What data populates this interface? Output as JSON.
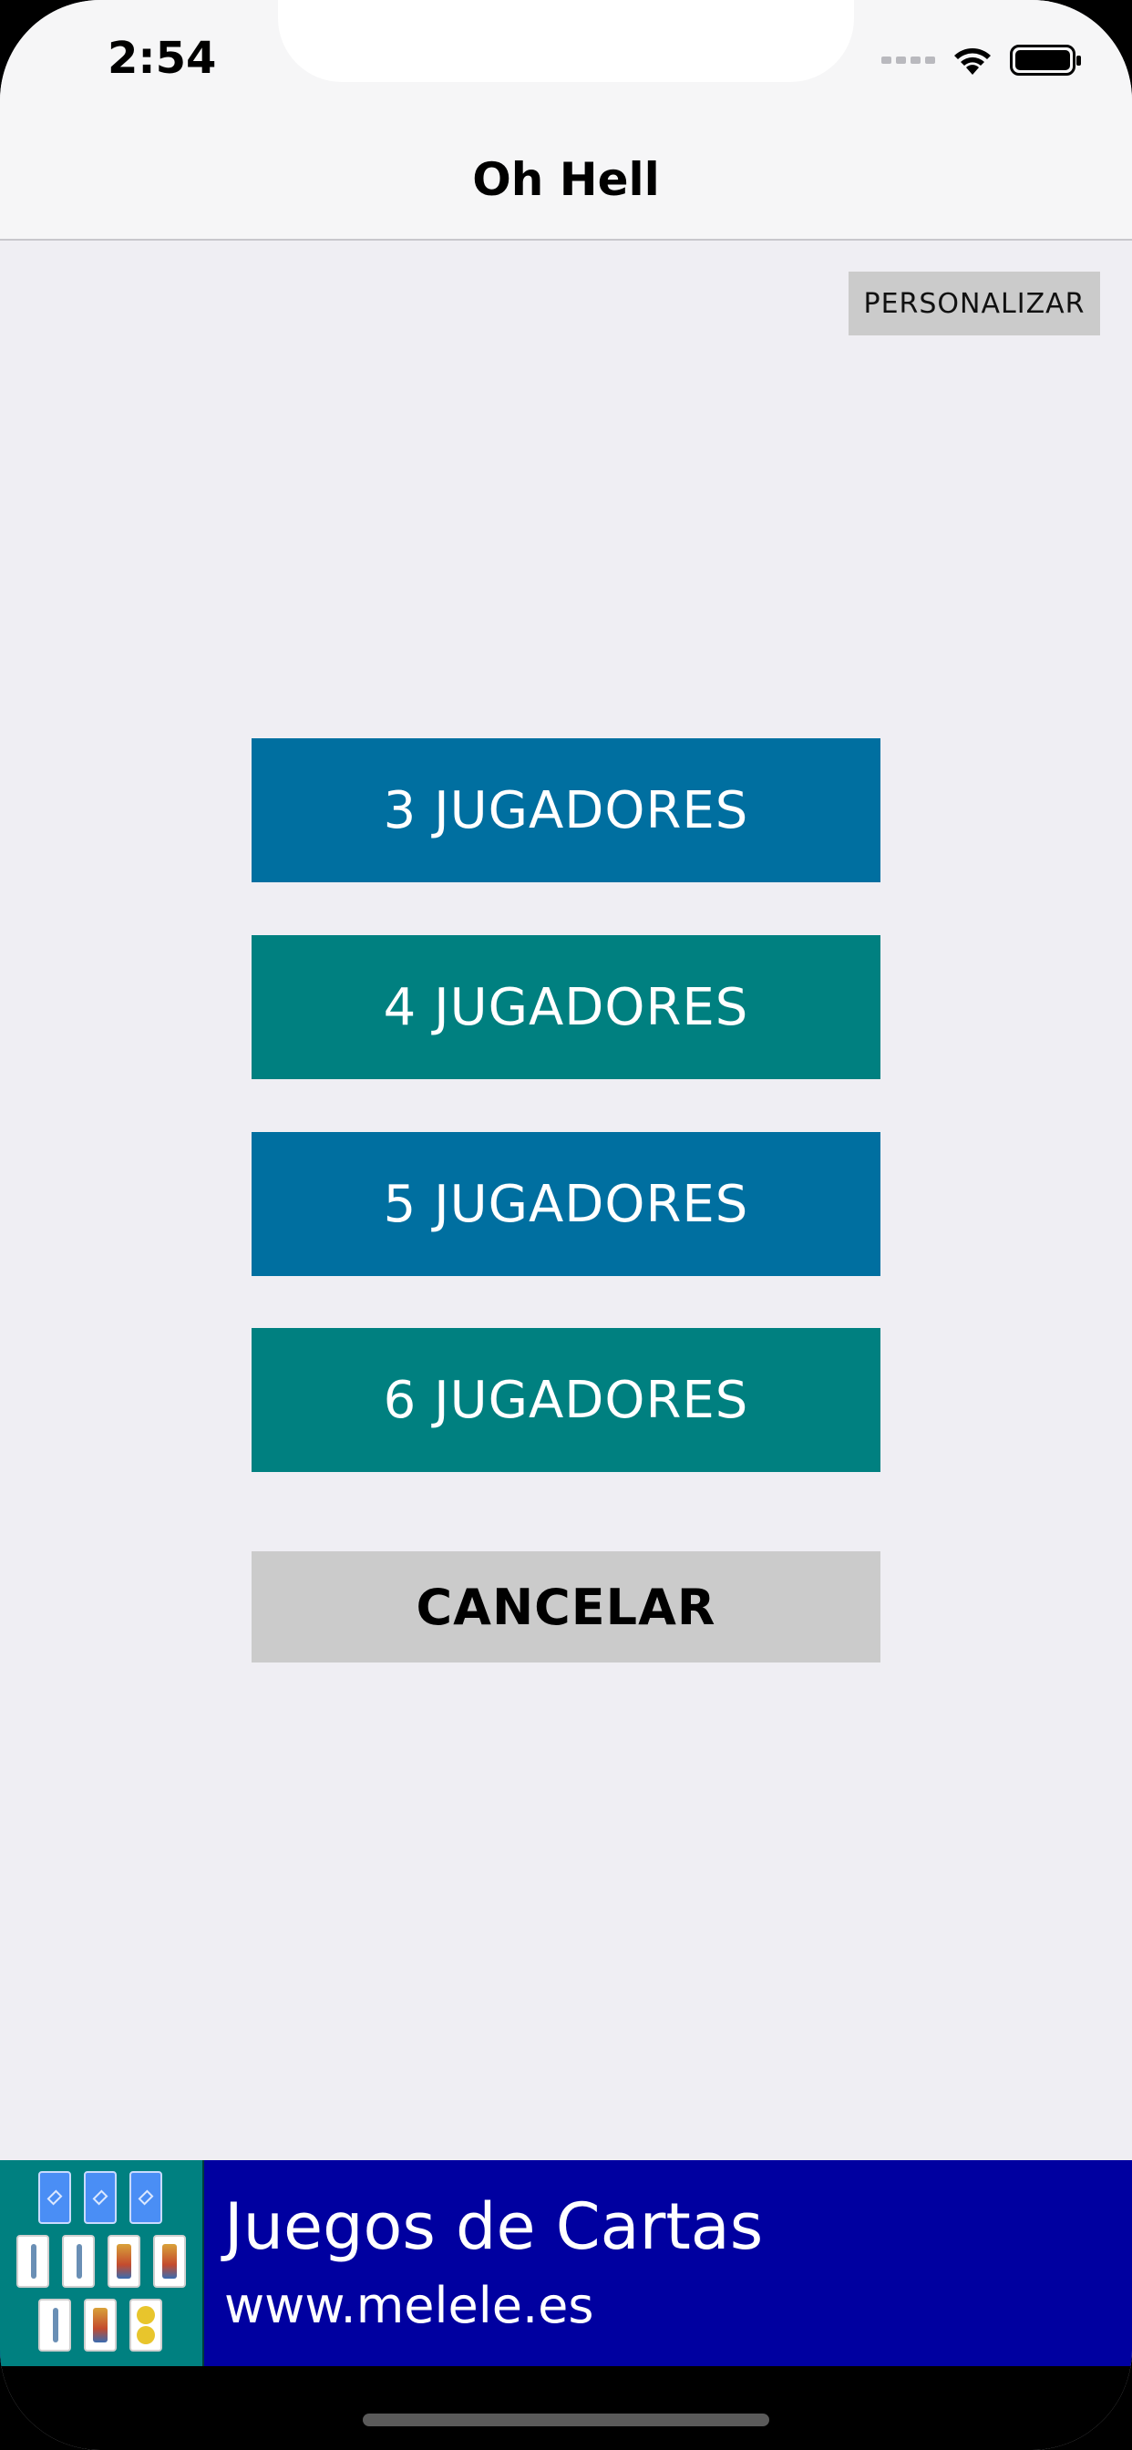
{
  "status_bar": {
    "time": "2:54",
    "icons": [
      "signal-dots-icon",
      "wifi-icon",
      "battery-icon"
    ]
  },
  "nav": {
    "title": "Oh Hell"
  },
  "toolbar": {
    "customize_label": "PERSONALIZAR"
  },
  "player_options": [
    {
      "label": "3 JUGADORES",
      "color": "#006fa0"
    },
    {
      "label": "4 JUGADORES",
      "color": "#008080"
    },
    {
      "label": "5 JUGADORES",
      "color": "#006fa0"
    },
    {
      "label": "6 JUGADORES",
      "color": "#008080"
    }
  ],
  "cancel_label": "CANCELAR",
  "banner": {
    "title": "Juegos de Cartas",
    "url": "www.melele.es",
    "background": "#0000a0",
    "image_background": "#008080"
  },
  "colors": {
    "page_background": "#efeef3",
    "nav_background": "#f6f6f7",
    "button_gray": "#cbcbcb"
  }
}
